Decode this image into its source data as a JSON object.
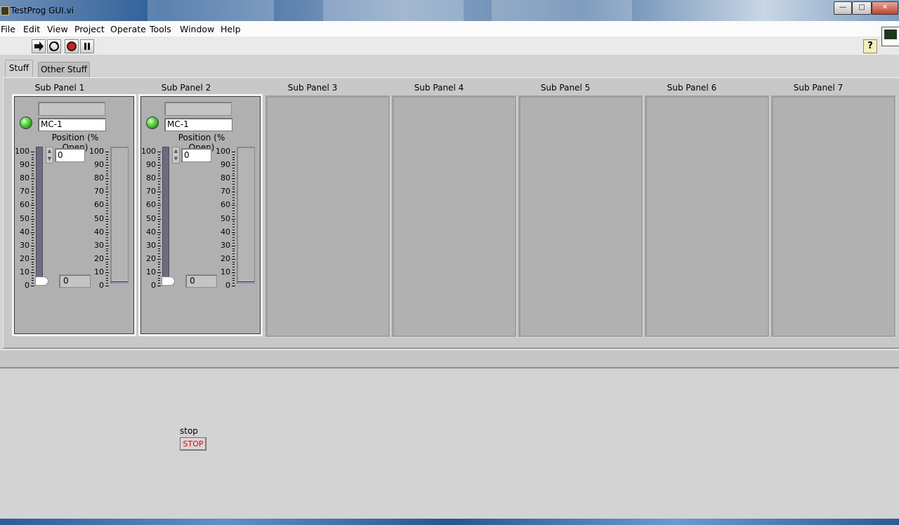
{
  "window": {
    "title": "TestProg GUI.vi",
    "minimize_glyph": "—",
    "maximize_glyph": "□",
    "close_glyph": "✕"
  },
  "menu": [
    "File",
    "Edit",
    "View",
    "Project",
    "Operate",
    "Tools",
    "Window",
    "Help"
  ],
  "toolbar": {
    "icons": [
      "run-icon",
      "run-continuously-icon",
      "abort-icon",
      "pause-icon"
    ],
    "help_glyph": "?"
  },
  "tabs": [
    {
      "label": "Stuff",
      "active": true
    },
    {
      "label": "Other Stuff",
      "active": false
    }
  ],
  "sub_panels": [
    {
      "label": "Sub Panel 1",
      "string_top": "",
      "name": "MC-1",
      "position_label": "Position (% Open)",
      "control_value": "0",
      "indicator_value": "0",
      "led": "on",
      "level": 0
    },
    {
      "label": "Sub Panel 2",
      "string_top": "",
      "name": "MC-1",
      "position_label": "Position (% Open)",
      "control_value": "0",
      "indicator_value": "0",
      "led": "on",
      "level": 0
    },
    {
      "label": "Sub Panel 3"
    },
    {
      "label": "Sub Panel 4"
    },
    {
      "label": "Sub Panel 5"
    },
    {
      "label": "Sub Panel 6"
    },
    {
      "label": "Sub Panel 7"
    }
  ],
  "scale": [
    "100",
    "90",
    "80",
    "70",
    "60",
    "50",
    "40",
    "30",
    "20",
    "10",
    "0"
  ],
  "spin_glyphs": {
    "up": "▲",
    "down": "▼"
  },
  "stop": {
    "label": "stop",
    "button": "STOP"
  },
  "colors": {
    "led_on": "#2fa11f",
    "stop_text": "#e00000",
    "slider_track": "#6c6c80",
    "tank_level": "#1e2aa0"
  }
}
